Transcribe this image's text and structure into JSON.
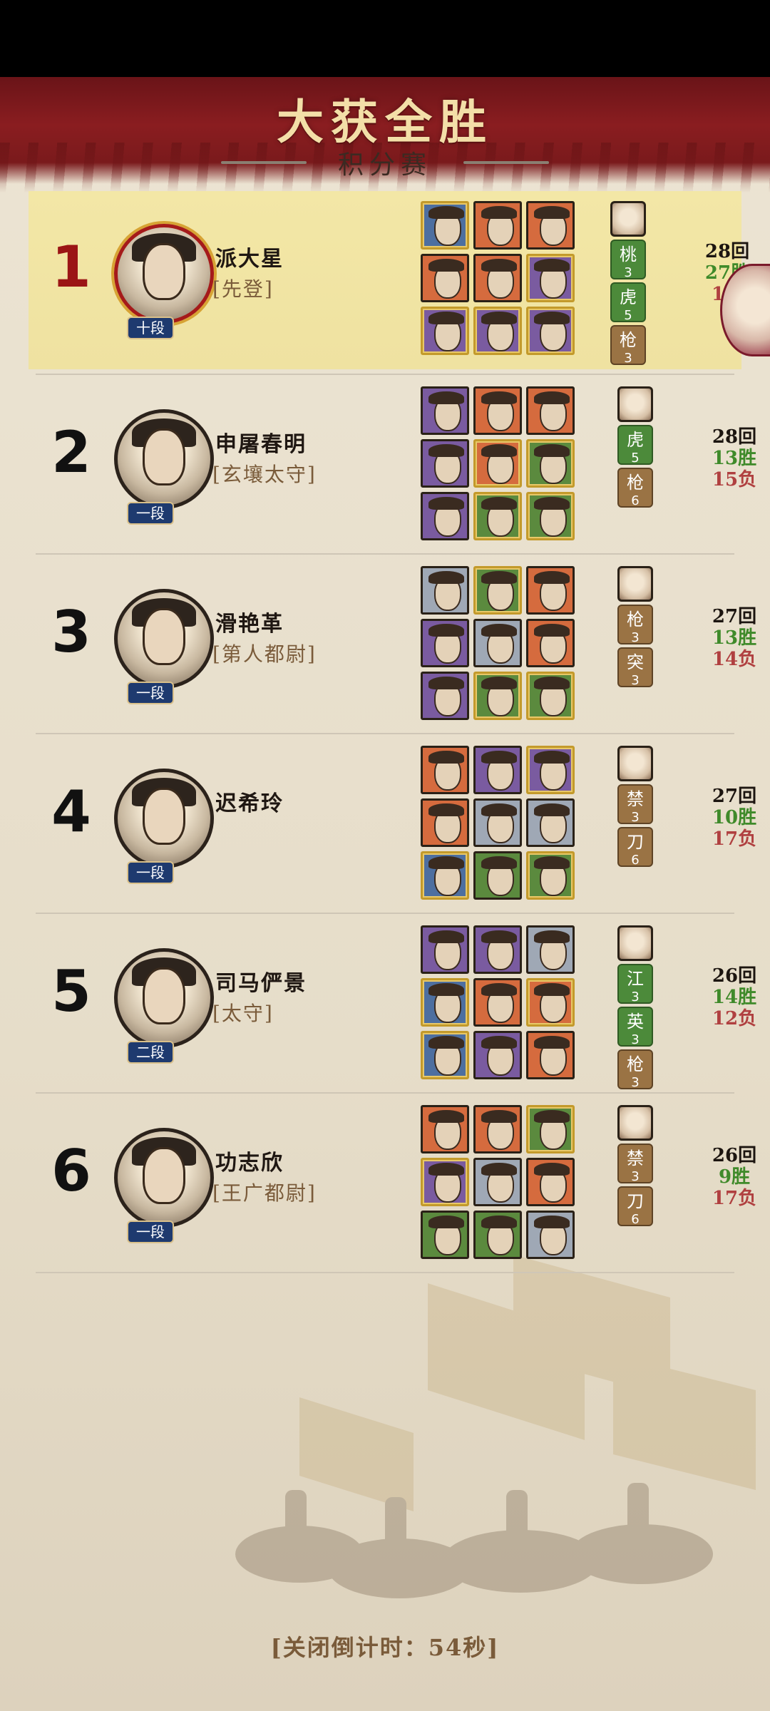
{
  "header": {
    "title": "大获全胜",
    "subtitle": "积分赛"
  },
  "players": [
    {
      "rank": "1",
      "name": "派大星",
      "title": "[先登]",
      "dan": "十段",
      "skills": [
        {
          "label": "桃",
          "level": "3",
          "color": "green"
        },
        {
          "label": "虎",
          "level": "5",
          "color": "green"
        },
        {
          "label": "枪",
          "level": "3",
          "color": "brown"
        }
      ],
      "stats": {
        "total": "28回",
        "wins": "27胜",
        "losses": "1负"
      }
    },
    {
      "rank": "2",
      "name": "申屠春明",
      "title": "[玄壤太守]",
      "dan": "一段",
      "skills": [
        {
          "label": "虎",
          "level": "5",
          "color": "green"
        },
        {
          "label": "枪",
          "level": "6",
          "color": "brown"
        }
      ],
      "stats": {
        "total": "28回",
        "wins": "13胜",
        "losses": "15负"
      }
    },
    {
      "rank": "3",
      "name": "滑艳革",
      "title": "[第人都尉]",
      "dan": "一段",
      "skills": [
        {
          "label": "枪",
          "level": "3",
          "color": "brown"
        },
        {
          "label": "突",
          "level": "3",
          "color": "brown"
        }
      ],
      "stats": {
        "total": "27回",
        "wins": "13胜",
        "losses": "14负"
      }
    },
    {
      "rank": "4",
      "name": "迟希玲",
      "title": "",
      "dan": "一段",
      "skills": [
        {
          "label": "禁",
          "level": "3",
          "color": "brown"
        },
        {
          "label": "刀",
          "level": "6",
          "color": "brown"
        }
      ],
      "stats": {
        "total": "27回",
        "wins": "10胜",
        "losses": "17负"
      }
    },
    {
      "rank": "5",
      "name": "司马俨景",
      "title": "[太守]",
      "dan": "二段",
      "skills": [
        {
          "label": "江",
          "level": "3",
          "color": "green"
        },
        {
          "label": "英",
          "level": "3",
          "color": "green"
        },
        {
          "label": "枪",
          "level": "3",
          "color": "brown"
        }
      ],
      "stats": {
        "total": "26回",
        "wins": "14胜",
        "losses": "12负"
      }
    },
    {
      "rank": "6",
      "name": "功志欣",
      "title": "[王广都尉]",
      "dan": "一段",
      "skills": [
        {
          "label": "禁",
          "level": "3",
          "color": "brown"
        },
        {
          "label": "刀",
          "level": "6",
          "color": "brown"
        }
      ],
      "stats": {
        "total": "26回",
        "wins": "9胜",
        "losses": "17负"
      }
    }
  ],
  "footer": {
    "countdown": "[关闭倒计时：54秒]"
  },
  "colors": {
    "banner": "#7a1a1c",
    "winner_highlight": "#f3e7a6",
    "win_text": "#3f8a2a",
    "loss_text": "#b04040",
    "dan_badge": "#1e3a6f"
  }
}
